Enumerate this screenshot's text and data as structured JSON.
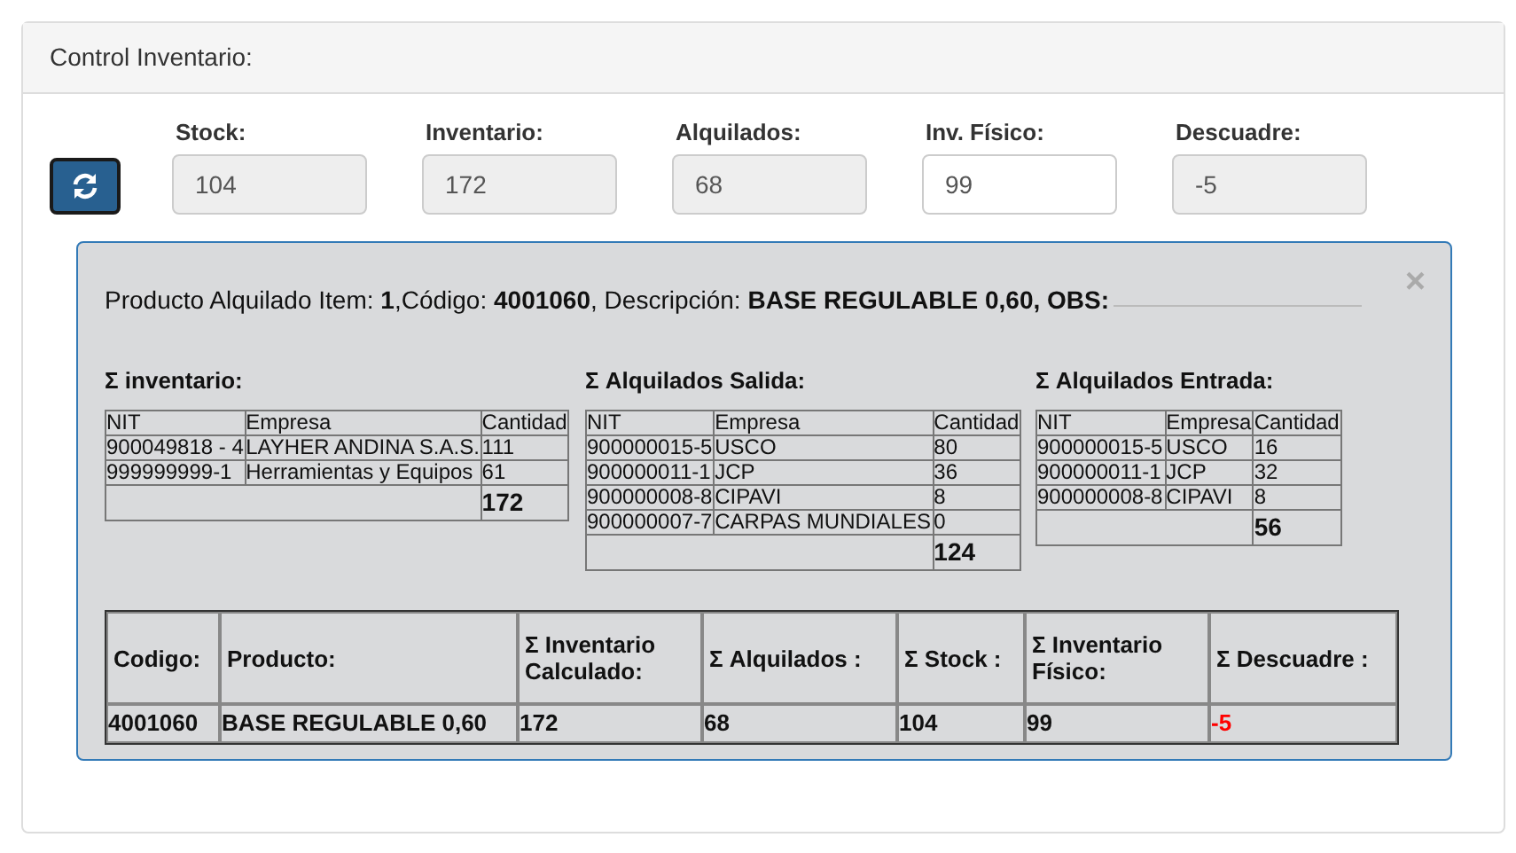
{
  "panel": {
    "title": "Control Inventario:"
  },
  "fields": [
    {
      "label": "Stock:",
      "value": "104",
      "readonly": true
    },
    {
      "label": "Inventario:",
      "value": "172",
      "readonly": true
    },
    {
      "label": "Alquilados:",
      "value": "68",
      "readonly": true
    },
    {
      "label": "Inv. Físico:",
      "value": "99",
      "readonly": false
    },
    {
      "label": "Descuadre:",
      "value": "-5",
      "readonly": true
    }
  ],
  "detail": {
    "heading": "Producto Alquilado Item: **1**,Código: **4001060**, Descripción: **BASE REGULABLE 0,60, OBS:**",
    "close": "×",
    "tables": [
      {
        "title": "Σ inventario:",
        "columns": [
          "NIT",
          "Empresa",
          "Cantidad"
        ],
        "rows": [
          [
            "900049818 - 4",
            "LAYHER ANDINA S.A.S.",
            "111"
          ],
          [
            "999999999-1",
            "Herramientas y Equipos",
            "61"
          ]
        ],
        "total": "172"
      },
      {
        "title": "Σ Alquilados Salida:",
        "columns": [
          "NIT",
          "Empresa",
          "Cantidad"
        ],
        "rows": [
          [
            "900000015-5",
            "USCO",
            "80"
          ],
          [
            "900000011-1",
            "JCP",
            "36"
          ],
          [
            "900000008-8",
            "CIPAVI",
            "8"
          ],
          [
            "900000007-7",
            "CARPAS MUNDIALES",
            "0"
          ]
        ],
        "total": "124"
      },
      {
        "title": "Σ Alquilados Entrada:",
        "columns": [
          "NIT",
          "Empresa",
          "Cantidad"
        ],
        "rows": [
          [
            "900000015-5",
            "USCO",
            "16"
          ],
          [
            "900000011-1",
            "JCP",
            "32"
          ],
          [
            "900000008-8",
            "CIPAVI",
            "8"
          ]
        ],
        "total": "56"
      }
    ],
    "summary": {
      "columns": [
        "Codigo:",
        "Producto:",
        "Σ Inventario Calculado:",
        "Σ Alquilados :",
        "Σ Stock :",
        "Σ Inventario Físico:",
        "Σ Descuadre :"
      ],
      "cells": [
        {
          "text": "4001060",
          "alert": false
        },
        {
          "text": "BASE REGULABLE 0,60",
          "alert": false
        },
        {
          "text": "172",
          "alert": false
        },
        {
          "text": "68",
          "alert": false
        },
        {
          "text": "104",
          "alert": false
        },
        {
          "text": "99",
          "alert": false
        },
        {
          "text": "-5",
          "alert": true
        }
      ]
    }
  }
}
